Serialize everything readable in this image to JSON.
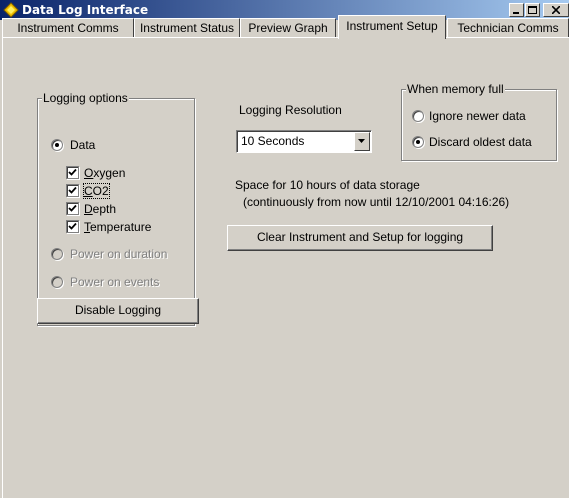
{
  "window": {
    "title": "Data Log Interface"
  },
  "tabs": [
    {
      "label": "Instrument Comms"
    },
    {
      "label": "Instrument Status"
    },
    {
      "label": "Preview Graph"
    },
    {
      "label": "Instrument Setup"
    },
    {
      "label": "Technician Comms"
    }
  ],
  "active_tab": "Instrument Setup",
  "logging_options": {
    "title": "Logging options",
    "data_label": "Data",
    "data_selected": true,
    "channels": [
      {
        "label": "Oxygen",
        "hotkey": "O",
        "rest": "xygen",
        "checked": true
      },
      {
        "label": "CO2",
        "hotkey": "C",
        "rest": "O2",
        "checked": true
      },
      {
        "label": "Depth",
        "hotkey": "D",
        "rest": "epth",
        "checked": true
      },
      {
        "label": "Temperature",
        "hotkey": "T",
        "rest": "emperature",
        "checked": true
      }
    ],
    "power_on_duration": "Power on duration",
    "power_on_events": "Power on events"
  },
  "disable_logging_button": "Disable Logging",
  "resolution": {
    "label": "Logging Resolution",
    "value": "10 Seconds"
  },
  "memory_full": {
    "title": "When memory full",
    "option_ignore": "Ignore newer data",
    "option_discard": "Discard oldest data",
    "selected": "Discard oldest data"
  },
  "storage": {
    "line1": "Space for 10 hours of data storage",
    "line2": "(continuously from now until 12/10/2001 04:16:26)"
  },
  "clear_button": "Clear Instrument and Setup for logging",
  "colors": {
    "face": "#d4d0c8",
    "title_start": "#0a246a",
    "title_end": "#a6caf0",
    "disabled_text": "#808080"
  }
}
